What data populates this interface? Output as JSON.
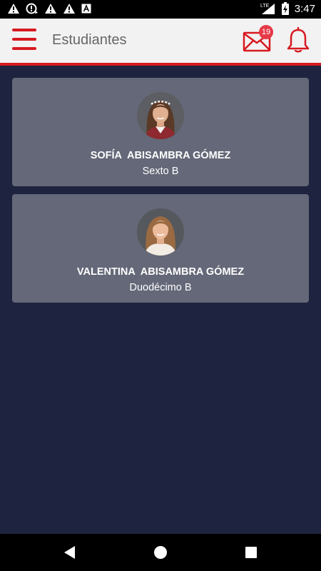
{
  "status_bar": {
    "time": "3:47",
    "network": "LTE",
    "icons": [
      "warning-icon",
      "sync-alert-icon",
      "warning-icon",
      "warning-icon",
      "font-a-icon",
      "signal-icon",
      "battery-charging-icon"
    ]
  },
  "app_bar": {
    "title": "Estudiantes",
    "mail_badge": "19",
    "accent_color": "#d71920"
  },
  "students": [
    {
      "name": "SOFÍA  ABISAMBRA GÓMEZ",
      "grade": "Sexto B"
    },
    {
      "name": "VALENTINA  ABISAMBRA GÓMEZ",
      "grade": "Duodécimo B"
    }
  ],
  "nav_bar": {
    "icons": [
      "back-icon",
      "home-icon",
      "recents-icon"
    ]
  }
}
